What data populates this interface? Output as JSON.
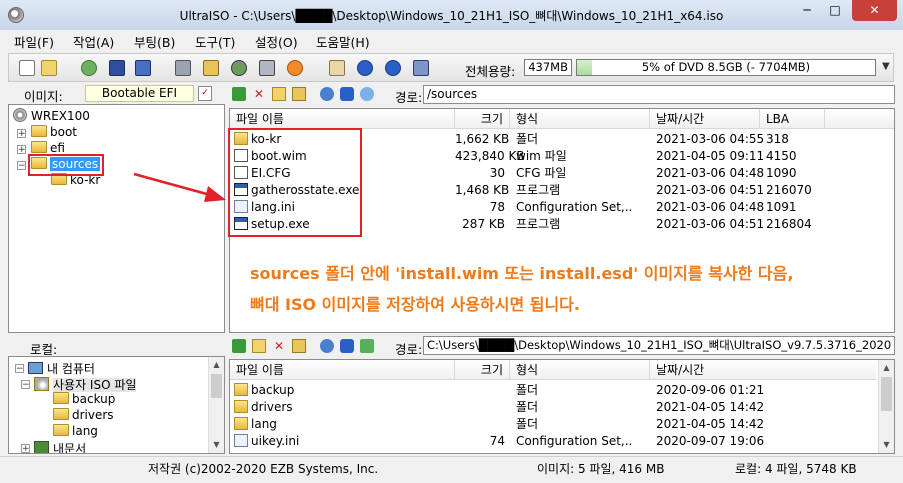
{
  "window": {
    "title": "UltraISO - C:\\Users\\████\\Desktop\\Windows_10_21H1_ISO_뼈대\\Windows_10_21H1_x64.iso",
    "min_glyph": "─",
    "max_glyph": "□",
    "close_glyph": "✕"
  },
  "menu": [
    "파일(F)",
    "작업(A)",
    "부팅(B)",
    "도구(T)",
    "설정(O)",
    "도움말(H)"
  ],
  "toolbar": {
    "total_label": "전체용량:",
    "total_size": "437MB",
    "capacity_text": "5% of DVD 8.5GB (- 7704MB)",
    "capacity_fraction": 0.05,
    "capacity_dropdown_glyph": "▼"
  },
  "image_row": {
    "label": "이미지:",
    "name": "Bootable EFI"
  },
  "top_tree": {
    "root": "WREX100",
    "items": [
      "boot",
      "efi",
      "sources",
      "ko-kr"
    ],
    "selected": "sources"
  },
  "top_path": {
    "label": "경로:",
    "value": "/sources"
  },
  "file_headers": [
    "파일 이름",
    "크기",
    "형식",
    "날짜/시간",
    "LBA"
  ],
  "top_files": [
    {
      "name": "ko-kr",
      "size": "1,662 KB",
      "type": "폴더",
      "date": "2021-03-06 04:55",
      "lba": "318",
      "icon": "folder-icon"
    },
    {
      "name": "boot.wim",
      "size": "423,840 KB",
      "type": "wim 파일",
      "date": "2021-04-05 09:11",
      "lba": "4150",
      "icon": "file-icon"
    },
    {
      "name": "EI.CFG",
      "size": "30",
      "type": "CFG 파일",
      "date": "2021-03-06 04:48",
      "lba": "1090",
      "icon": "file-icon"
    },
    {
      "name": "gatherosstate.exe",
      "size": "1,468 KB",
      "type": "프로그램",
      "date": "2021-03-06 04:51",
      "lba": "216070",
      "icon": "exe-icon"
    },
    {
      "name": "lang.ini",
      "size": "78",
      "type": "Configuration Set,..",
      "date": "2021-03-06 04:48",
      "lba": "1091",
      "icon": "ini-icon"
    },
    {
      "name": "setup.exe",
      "size": "287 KB",
      "type": "프로그램",
      "date": "2021-03-06 04:51",
      "lba": "216804",
      "icon": "exe-icon"
    }
  ],
  "annotation": {
    "line1": "sources 폴더 안에 'install.wim 또는 install.esd' 이미지를 복사한 다음,",
    "line2": "뼈대 ISO 이미지를 저장하여 사용하시면 됩니다.",
    "color": "#ee7a1a",
    "box_color": "#e2222a"
  },
  "local_label": "로컬:",
  "bottom_tree": {
    "items": [
      "내 컴퓨터",
      "사용자 ISO 파일",
      "backup",
      "drivers",
      "lang",
      "내문서"
    ]
  },
  "bottom_path": {
    "label": "경로:",
    "value": "C:\\Users\\████\\Desktop\\Windows_10_21H1_ISO_뼈대\\UltraISO_v9.7.5.3716_2020"
  },
  "bottom_files": [
    {
      "name": "backup",
      "size": "",
      "type": "폴더",
      "date": "2020-09-06 01:21",
      "icon": "folder-icon"
    },
    {
      "name": "drivers",
      "size": "",
      "type": "폴더",
      "date": "2021-04-05 14:42",
      "icon": "folder-icon"
    },
    {
      "name": "lang",
      "size": "",
      "type": "폴더",
      "date": "2021-04-05 14:42",
      "icon": "folder-icon"
    },
    {
      "name": "uikey.ini",
      "size": "74",
      "type": "Configuration Set,..",
      "date": "2020-09-07 19:06",
      "icon": "ini-icon"
    }
  ],
  "status": {
    "copyright": "저작권 (c)2002-2020 EZB Systems, Inc.",
    "image_info": "이미지: 5 파일, 416 MB",
    "local_info": "로컬: 4 파일, 5748 KB"
  }
}
